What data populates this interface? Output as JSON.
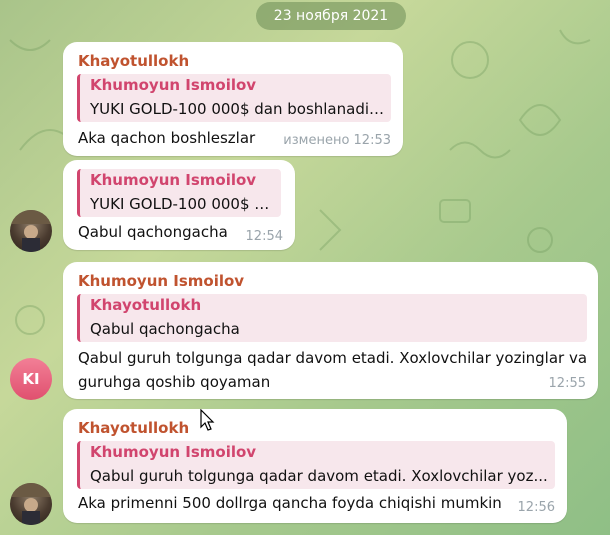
{
  "date_separator": "23 ноября 2021",
  "messages": [
    {
      "sender": "Khayotullokh",
      "reply_name": "Khumoyun Ismoilov",
      "reply_text": "YUKI GOLD-100 000$ dan boshlanadi ...",
      "text": "Aka qachon boshleszlar",
      "time": "изменено 12:53"
    },
    {
      "reply_name": "Khumoyun Ismoilov",
      "reply_text": "YUKI GOLD-100 000$ d...",
      "text": "Qabul qachongacha",
      "time": "12:54"
    },
    {
      "sender": "Khumoyun Ismoilov",
      "reply_name": "Khayotullokh",
      "reply_text": "Qabul qachongacha",
      "text": "Qabul guruh tolgunga qadar davom etadi. Xoxlovchilar yozinglar va guruhga qoshib qoyaman",
      "time": "12:55",
      "avatar_initials": "KI"
    },
    {
      "sender": "Khayotullokh",
      "reply_name": "Khumoyun Ismoilov",
      "reply_text": "Qabul guruh tolgunga qadar davom etadi. Xoxlovchilar yoz...",
      "text": "Aka primenni 500 dollrga qancha foyda chiqishi mumkin",
      "time": "12:56"
    }
  ],
  "colors": {
    "sender_name": "#c0532f",
    "reply_accent": "#d1456e",
    "reply_bg": "#f7e7ec",
    "avatar_pink": "#e0506f"
  }
}
